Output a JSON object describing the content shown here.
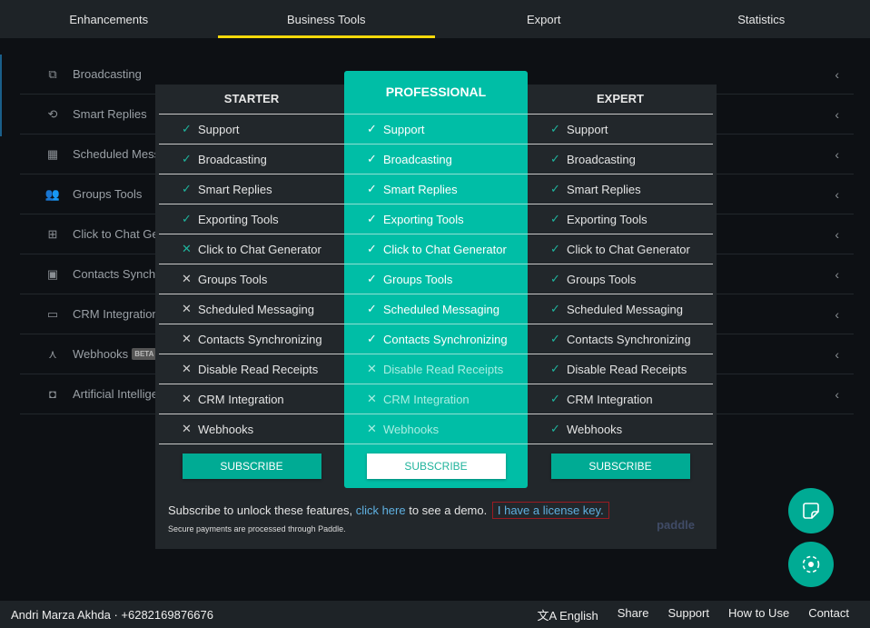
{
  "tabs": [
    "Enhancements",
    "Business Tools",
    "Export",
    "Statistics"
  ],
  "sidebar": [
    {
      "label": "Broadcasting",
      "icon": "broadcast-icon"
    },
    {
      "label": "Smart Replies",
      "icon": "smart-replies-icon"
    },
    {
      "label": "Scheduled Mess",
      "icon": "calendar-icon"
    },
    {
      "label": "Groups Tools",
      "icon": "groups-icon"
    },
    {
      "label": "Click to Chat Ge",
      "icon": "chat-plus-icon"
    },
    {
      "label": "Contacts Synchr",
      "icon": "contacts-icon"
    },
    {
      "label": "CRM Integration",
      "icon": "crm-icon"
    },
    {
      "label": "Webhooks",
      "icon": "webhook-icon",
      "badge": "BETA"
    },
    {
      "label": "Artificial Intellige",
      "icon": "chip-icon"
    }
  ],
  "plans": [
    {
      "name": "STARTER",
      "features": [
        [
          "Support",
          1
        ],
        [
          "Broadcasting",
          1
        ],
        [
          "Smart Replies",
          1
        ],
        [
          "Exporting Tools",
          1
        ],
        [
          "Click to Chat Generator",
          0
        ],
        [
          "Groups Tools",
          0
        ],
        [
          "Scheduled Messaging",
          0
        ],
        [
          "Contacts Synchronizing",
          0
        ],
        [
          "Disable Read Receipts",
          0
        ],
        [
          "CRM Integration",
          0
        ],
        [
          "Webhooks",
          0
        ]
      ],
      "button": "SUBSCRIBE"
    },
    {
      "name": "PROFESSIONAL",
      "features": [
        [
          "Support",
          1
        ],
        [
          "Broadcasting",
          1
        ],
        [
          "Smart Replies",
          1
        ],
        [
          "Exporting Tools",
          1
        ],
        [
          "Click to Chat Generator",
          1
        ],
        [
          "Groups Tools",
          1
        ],
        [
          "Scheduled Messaging",
          1
        ],
        [
          "Contacts Synchronizing",
          1
        ],
        [
          "Disable Read Receipts",
          0
        ],
        [
          "CRM Integration",
          0
        ],
        [
          "Webhooks",
          0
        ]
      ],
      "button": "SUBSCRIBE"
    },
    {
      "name": "EXPERT",
      "features": [
        [
          "Support",
          1
        ],
        [
          "Broadcasting",
          1
        ],
        [
          "Smart Replies",
          1
        ],
        [
          "Exporting Tools",
          1
        ],
        [
          "Click to Chat Generator",
          1
        ],
        [
          "Groups Tools",
          1
        ],
        [
          "Scheduled Messaging",
          1
        ],
        [
          "Contacts Synchronizing",
          1
        ],
        [
          "Disable Read Receipts",
          1
        ],
        [
          "CRM Integration",
          1
        ],
        [
          "Webhooks",
          1
        ]
      ],
      "button": "SUBSCRIBE"
    }
  ],
  "footer": {
    "text1": "Subscribe to unlock these features, ",
    "link": "click here",
    "text2": " to see a demo.",
    "license": "I have a license key.",
    "secure": "Secure payments are processed through Paddle.",
    "paddle": "paddle"
  },
  "bottom": {
    "user": "Andri Marza Akhda · +6282169876676",
    "links": [
      "English",
      "Share",
      "Support",
      "How to Use",
      "Contact"
    ]
  },
  "colors": {
    "accent": "#00bea6",
    "tab_indicator": "#f5d90a"
  }
}
